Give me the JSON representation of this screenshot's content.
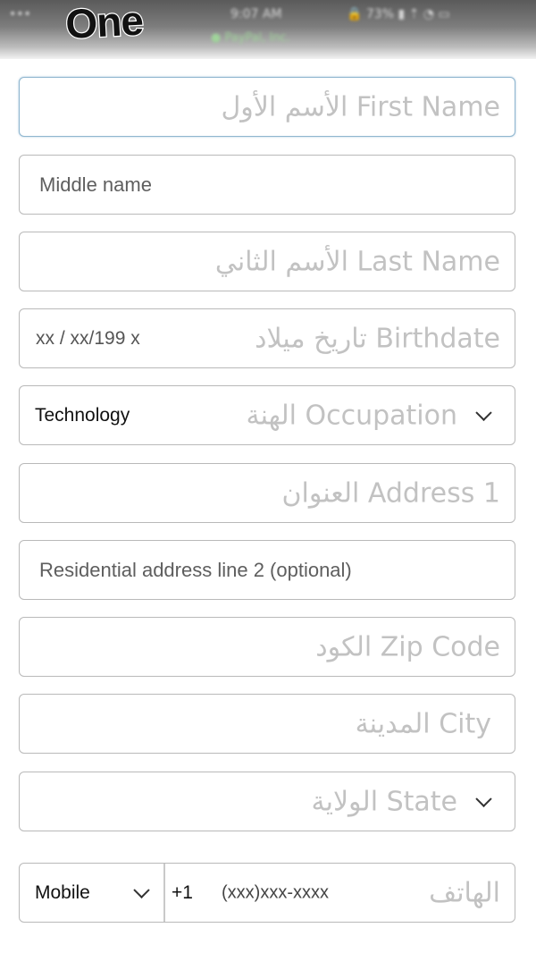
{
  "status_bar": {
    "carrier": "•••",
    "time": "9:07 AM",
    "network_label": "● PayPal, Inc.",
    "right_icons": "🔒 73% ▮ ⇡ ◔ ▭"
  },
  "brand": {
    "logo_text": "One"
  },
  "form": {
    "first_name": {
      "placeholder": "الأسم الأول First Name"
    },
    "middle_name": {
      "value": "Middle name"
    },
    "last_name": {
      "placeholder": "الأسم الثاني Last Name"
    },
    "birthdate": {
      "placeholder": "تاريخ ميلاد Birthdate",
      "value": "xx / xx/199 x"
    },
    "occupation": {
      "placeholder": "الهنة Occupation",
      "value": "Technology",
      "icon": "chevron-down-icon"
    },
    "address1": {
      "placeholder": "العنوان Address 1"
    },
    "address2": {
      "value": "Residential address line 2 (optional)"
    },
    "zip": {
      "placeholder": "الكود Zip Code"
    },
    "city": {
      "placeholder": "المدينة City"
    },
    "state": {
      "placeholder": "الولاية State",
      "icon": "chevron-down-icon"
    },
    "phone": {
      "type_value": "Mobile",
      "country_code": "+1",
      "mask": "(xxx)xxx-xxxx",
      "placeholder": "الهاتف"
    }
  },
  "colors": {
    "border": "#b9b9b9",
    "focus_border": "#8fb6cf",
    "placeholder": "#c2c2c2"
  }
}
